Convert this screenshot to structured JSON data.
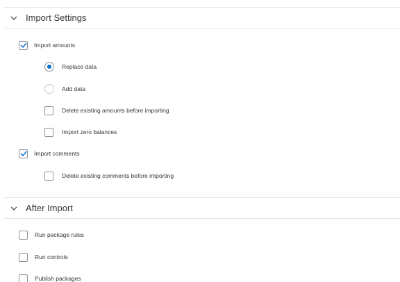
{
  "sections": {
    "import_settings": {
      "title": "Import Settings",
      "import_amounts": {
        "label": "Import amounts",
        "checked": true
      },
      "replace_data": {
        "label": "Replace data",
        "selected": true
      },
      "add_data": {
        "label": "Add data",
        "selected": false
      },
      "delete_existing_amounts": {
        "label": "Delete existing amounts before importing",
        "checked": false
      },
      "import_zero_balances": {
        "label": "Import zero balances",
        "checked": false
      },
      "import_comments": {
        "label": "Import comments",
        "checked": true
      },
      "delete_existing_comments": {
        "label": "Delete existing comments before importing",
        "checked": false
      }
    },
    "after_import": {
      "title": "After Import",
      "run_package_rules": {
        "label": "Run package rules",
        "checked": false
      },
      "run_controls": {
        "label": "Run controls",
        "checked": false
      },
      "publish_packages": {
        "label": "Publish packages",
        "checked": false
      }
    }
  },
  "colors": {
    "accent": "#0a6ed1",
    "text": "#32363a",
    "border": "#89919a",
    "divider": "#e5e5e5"
  }
}
